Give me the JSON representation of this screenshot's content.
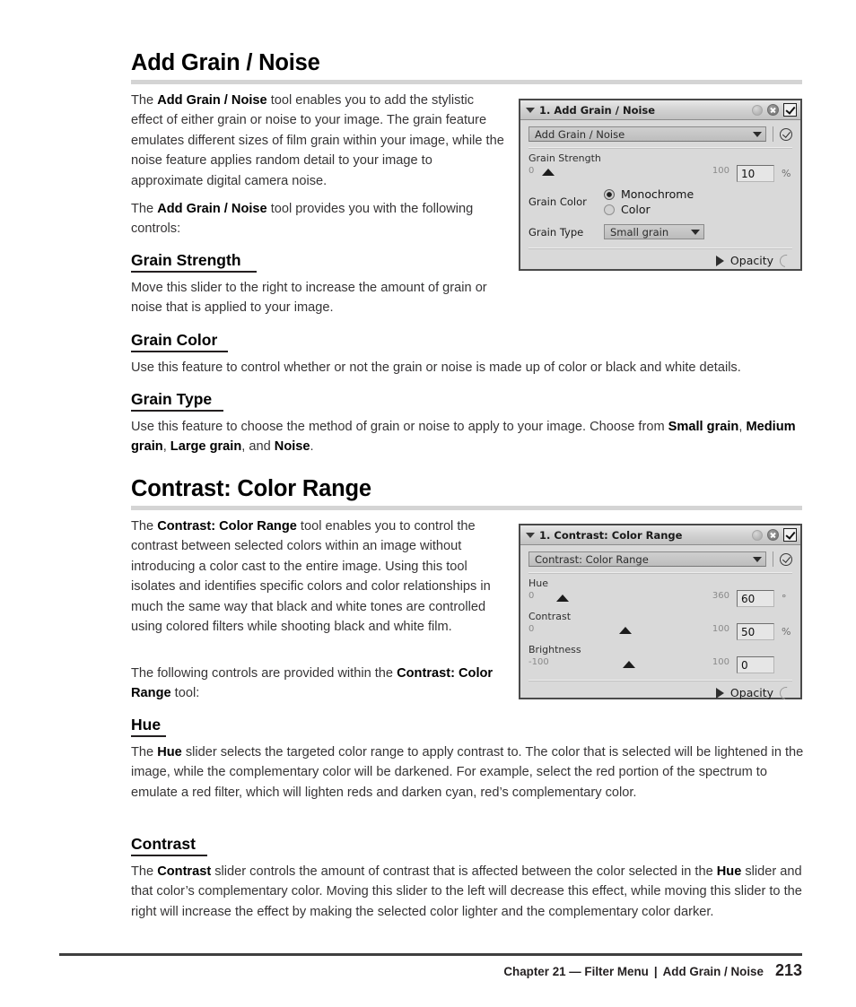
{
  "sections": {
    "grain": {
      "heading": "Add Grain / Noise",
      "intro_p1_prefix": "The ",
      "intro_p1_bold": "Add Grain / Noise",
      "intro_p1_rest": " tool enables you to add the stylistic effect of either grain or noise to your image. The grain feature emulates different sizes of film grain within your image, while the noise feature applies random detail to your image to approximate digital camera noise.",
      "intro_p2_prefix": "The ",
      "intro_p2_bold": "Add Grain / Noise",
      "intro_p2_rest": " tool provides you with the following controls:",
      "sub1_heading": "Grain Strength",
      "sub1_body": "Move this slider to the right to increase the amount of grain or noise that is applied to your image.",
      "sub2_heading": "Grain Color",
      "sub2_body": "Use this feature to control whether or not the grain or noise is made up of color or black and white details.",
      "sub3_heading": "Grain Type",
      "sub3_body_a": "Use this feature to choose the method of grain or noise to apply to your image. Choose from ",
      "sub3_b1": "Small grain",
      "sub3_body_b": ", ",
      "sub3_b2": "Medium grain",
      "sub3_body_c": ", ",
      "sub3_b3": "Large grain",
      "sub3_body_d": ", and ",
      "sub3_b4": "Noise",
      "sub3_body_e": "."
    },
    "contrast": {
      "heading": "Contrast: Color Range",
      "intro_p1_prefix": "The ",
      "intro_p1_bold": "Contrast: Color Range",
      "intro_p1_rest": " tool enables you to control the contrast between selected colors within an image without introducing a color cast to the entire image. Using this tool isolates and identifies specific colors and color relationships in much the same way that black and white tones are controlled using colored filters while shooting black and white film.",
      "intro_p2_prefix": "The following controls are provided within the ",
      "intro_p2_bold": "Contrast: Color Range",
      "intro_p2_rest": " tool:",
      "sub1_heading": "Hue",
      "sub1_body_a": "The ",
      "sub1_b1": "Hue",
      "sub1_body_b": " slider selects the targeted color range to apply contrast to. The color that is selected will be lightened in the image, while the complementary color will be darkened. For example, select the red portion of the spectrum to emulate a red filter, which will lighten reds and darken cyan, red’s complementary color.",
      "sub2_heading": "Contrast",
      "sub2_body_a": "The ",
      "sub2_b1": "Contrast",
      "sub2_body_b": " slider controls the amount of contrast that is affected between the color selected in the ",
      "sub2_b2": "Hue",
      "sub2_body_c": " slider and that color’s complementary color. Moving this slider to the left will decrease this effect, while moving this slider to the right will increase the effect by making the selected color lighter and the complementary color darker."
    }
  },
  "panel_grain": {
    "title": "1. Add Grain / Noise",
    "filter_name": "Add Grain / Noise",
    "grain_strength": {
      "label": "Grain Strength",
      "min": "0",
      "max": "100",
      "value": "10",
      "unit": "%"
    },
    "grain_color": {
      "label": "Grain Color",
      "options": [
        "Monochrome",
        "Color"
      ],
      "selected": "Monochrome"
    },
    "grain_type": {
      "label": "Grain Type",
      "value": "Small grain"
    },
    "opacity_label": "Opacity"
  },
  "panel_contrast": {
    "title": "1. Contrast: Color Range",
    "filter_name": "Contrast: Color Range",
    "hue": {
      "label": "Hue",
      "min": "0",
      "max": "360",
      "value": "60",
      "unit": "°"
    },
    "contrast": {
      "label": "Contrast",
      "min": "0",
      "max": "100",
      "value": "50",
      "unit": "%"
    },
    "brightness": {
      "label": "Brightness",
      "min": "-100",
      "max": "100",
      "value": "0",
      "unit": ""
    },
    "opacity_label": "Opacity"
  },
  "footer": {
    "chapter": "Chapter 21 — Filter Menu",
    "separator": "|",
    "topic": "Add Grain / Noise",
    "page_number": "213"
  }
}
